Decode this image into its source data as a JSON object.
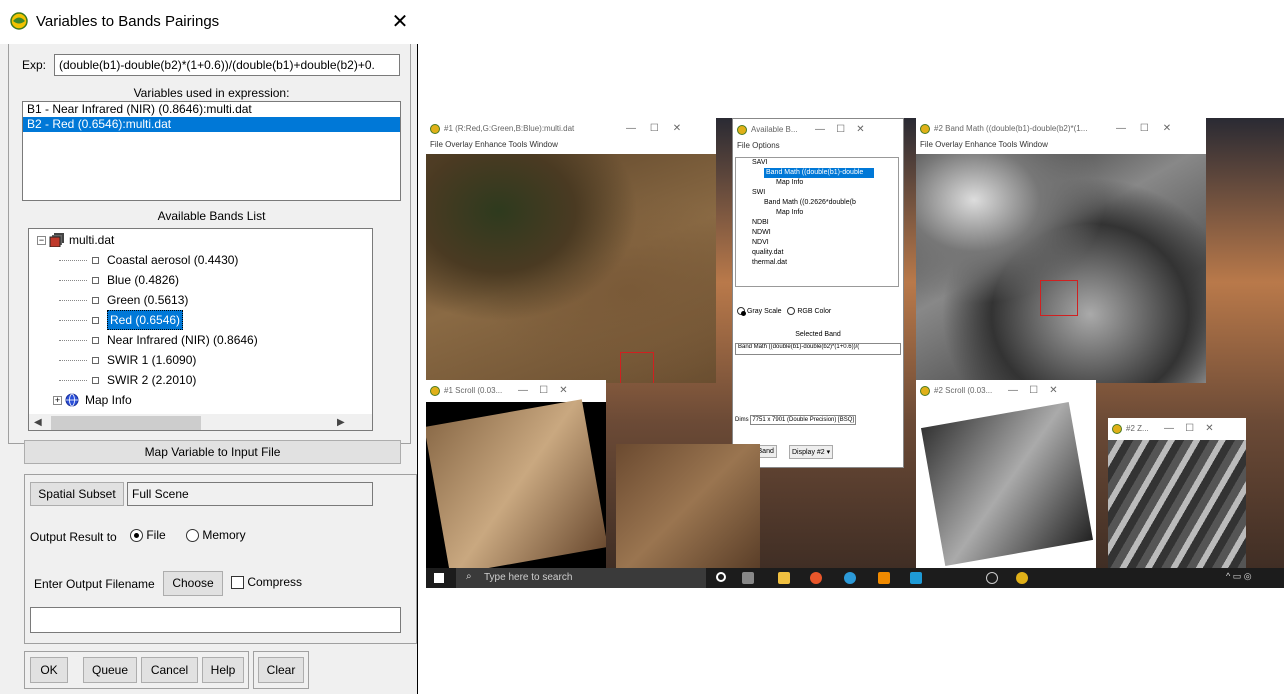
{
  "dialog": {
    "title": "Variables to Bands Pairings",
    "close_glyph": "✕",
    "exp_label": "Exp:",
    "expression": "(double(b1)-double(b2)*(1+0.6))/(double(b1)+double(b2)+0.",
    "variables_label": "Variables used in expression:",
    "variables": [
      "B1 - Near Infrared (NIR) (0.8646):multi.dat",
      "B2 - Red (0.6546):multi.dat"
    ],
    "bands_list_label": "Available Bands List",
    "file_name": "multi.dat",
    "bands": [
      "Coastal aerosol (0.4430)",
      "Blue (0.4826)",
      "Green (0.5613)",
      "Red (0.6546)",
      "Near Infrared (NIR) (0.8646)",
      "SWIR 1 (1.6090)",
      "SWIR 2 (2.2010)"
    ],
    "map_info": "Map Info",
    "map_variable_button": "Map Variable to Input File",
    "spatial_subset_button": "Spatial Subset",
    "spatial_subset_value": "Full Scene",
    "output_label": "Output Result to",
    "output_file": "File",
    "output_memory": "Memory",
    "filename_label": "Enter Output Filename",
    "choose_button": "Choose",
    "compress_label": "Compress",
    "filename_value": "",
    "ok_button": "OK",
    "queue_button": "Queue",
    "cancel_button": "Cancel",
    "help_button": "Help",
    "clear_button": "Clear"
  },
  "screenshot": {
    "win1_title": "#1 (R:Red,G:Green,B:Blue):multi.dat",
    "win1_menu": "File  Overlay  Enhance  Tools  Window",
    "avail_title": "Available B...",
    "avail_menu": "File  Options",
    "avail_items": [
      "SAVI",
      "Band Math ((double(b1)-double",
      "Map Info",
      "SWI",
      "Band Math ((0.2626*double(b",
      "Map Info",
      "NDBI",
      "NDWI",
      "NDVI",
      "quality.dat",
      "thermal.dat"
    ],
    "gray_scale": "Gray Scale",
    "rgb_color": "RGB Color",
    "selected_band_label": "Selected Band",
    "selected_band": "Band Math ((double(b1)-double(b2)*(1+0.6))/(",
    "dims_label": "Dims",
    "dims_value": "7751 x 7901 (Double Precision) [BSQ]",
    "load_band": "Load Band",
    "display": "Display #2",
    "win2_title": "#2 Band Math ((double(b1)-double(b2)*(1...",
    "win2_menu": "File  Overlay  Enhance  Tools  Window",
    "scroll1_title": "#1 Scroll (0.03...",
    "scroll2_title": "#2 Scroll (0.03...",
    "zoom2_title": "#2 Z...",
    "search_placeholder": "Type here to search"
  }
}
